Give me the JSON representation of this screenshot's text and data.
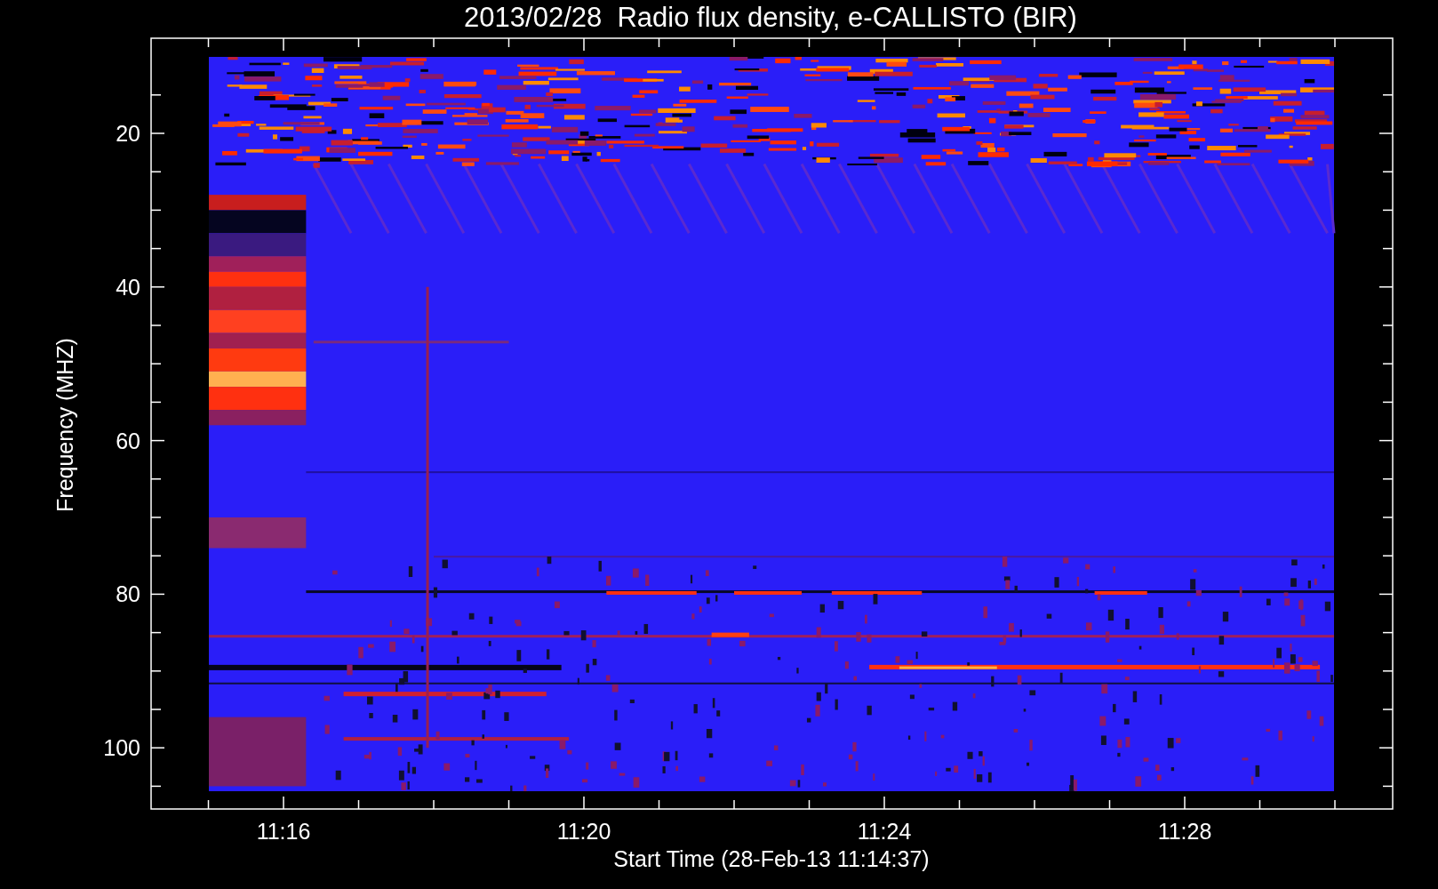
{
  "title": "2013/02/28  Radio flux density, e-CALLISTO (BIR)",
  "y_axis": {
    "label": "Frequency (MHZ)",
    "ticks": [
      "20",
      "40",
      "60",
      "80",
      "100"
    ]
  },
  "x_axis": {
    "label": "Start Time (28-Feb-13 11:14:37)",
    "ticks": [
      "11:16",
      "11:20",
      "11:24",
      "11:28"
    ]
  }
}
